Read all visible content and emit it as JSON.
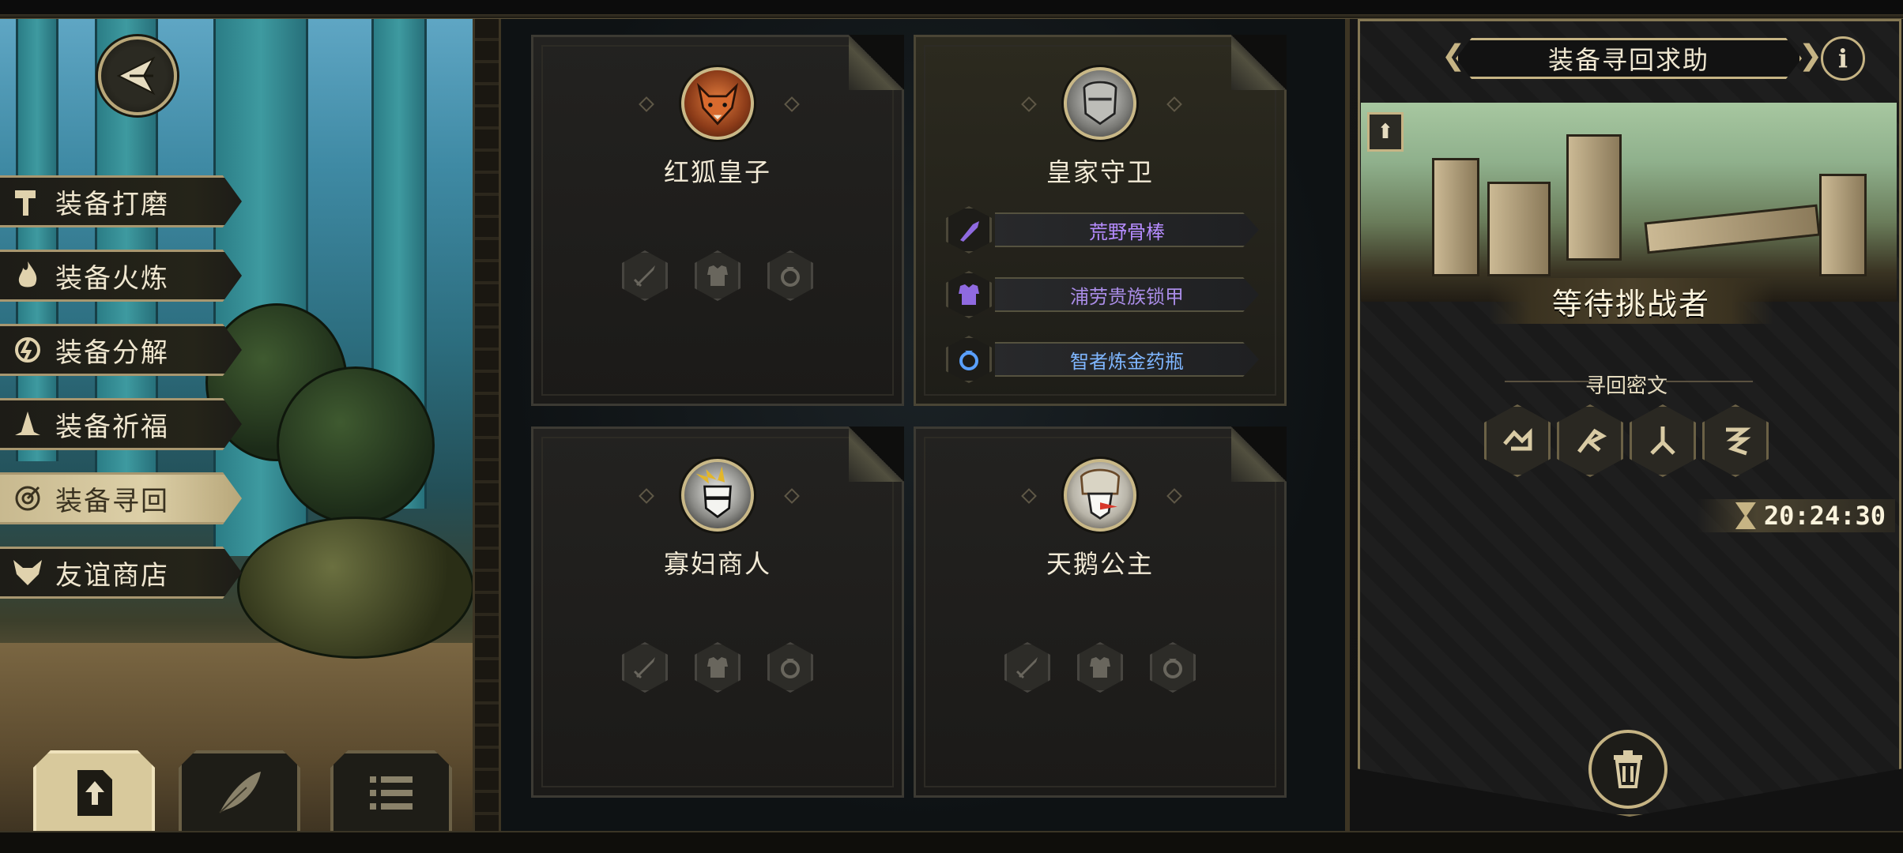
{
  "menu": {
    "items": [
      {
        "label": "装备打磨",
        "icon": "hammer-icon",
        "active": false
      },
      {
        "label": "装备火炼",
        "icon": "flame-icon",
        "active": false
      },
      {
        "label": "装备分解",
        "icon": "decompose-icon",
        "active": false
      },
      {
        "label": "装备祈福",
        "icon": "praying-hands-icon",
        "active": false
      },
      {
        "label": "装备寻回",
        "icon": "target-icon",
        "active": true
      },
      {
        "label": "友谊商店",
        "icon": "fox-icon",
        "active": false
      }
    ]
  },
  "bottom_tabs": [
    {
      "icon": "upload-document-icon",
      "active": true
    },
    {
      "icon": "feather-icon",
      "active": false
    },
    {
      "icon": "list-icon",
      "active": false
    }
  ],
  "characters": [
    {
      "name": "红狐皇子",
      "portrait": "red-fox-portrait",
      "equipment": []
    },
    {
      "name": "皇家守卫",
      "portrait": "royal-guard-portrait",
      "equipment": [
        {
          "name": "荒野骨棒",
          "icon": "club-icon",
          "color": "#b68cff"
        },
        {
          "name": "浦劳贵族锁甲",
          "icon": "armor-icon",
          "color": "#a98ce6"
        },
        {
          "name": "智者炼金药瓶",
          "icon": "ring-icon",
          "color": "#7fb6ff"
        }
      ]
    },
    {
      "name": "寡妇商人",
      "portrait": "widow-merchant-portrait",
      "equipment": []
    },
    {
      "name": "天鹅公主",
      "portrait": "swan-princess-portrait",
      "equipment": []
    }
  ],
  "recovery": {
    "title": "装备寻回求助",
    "status": "等待挑战者",
    "cipher_label": "寻回密文",
    "runes": [
      "rune-1-icon",
      "rune-2-icon",
      "rune-3-icon",
      "rune-4-icon"
    ],
    "timer": "20:24:30",
    "info_label": "i"
  },
  "colors": {
    "accent_gold": "#c6b484",
    "equip_purple": "#b68cff",
    "equip_blue": "#7fb6ff"
  }
}
